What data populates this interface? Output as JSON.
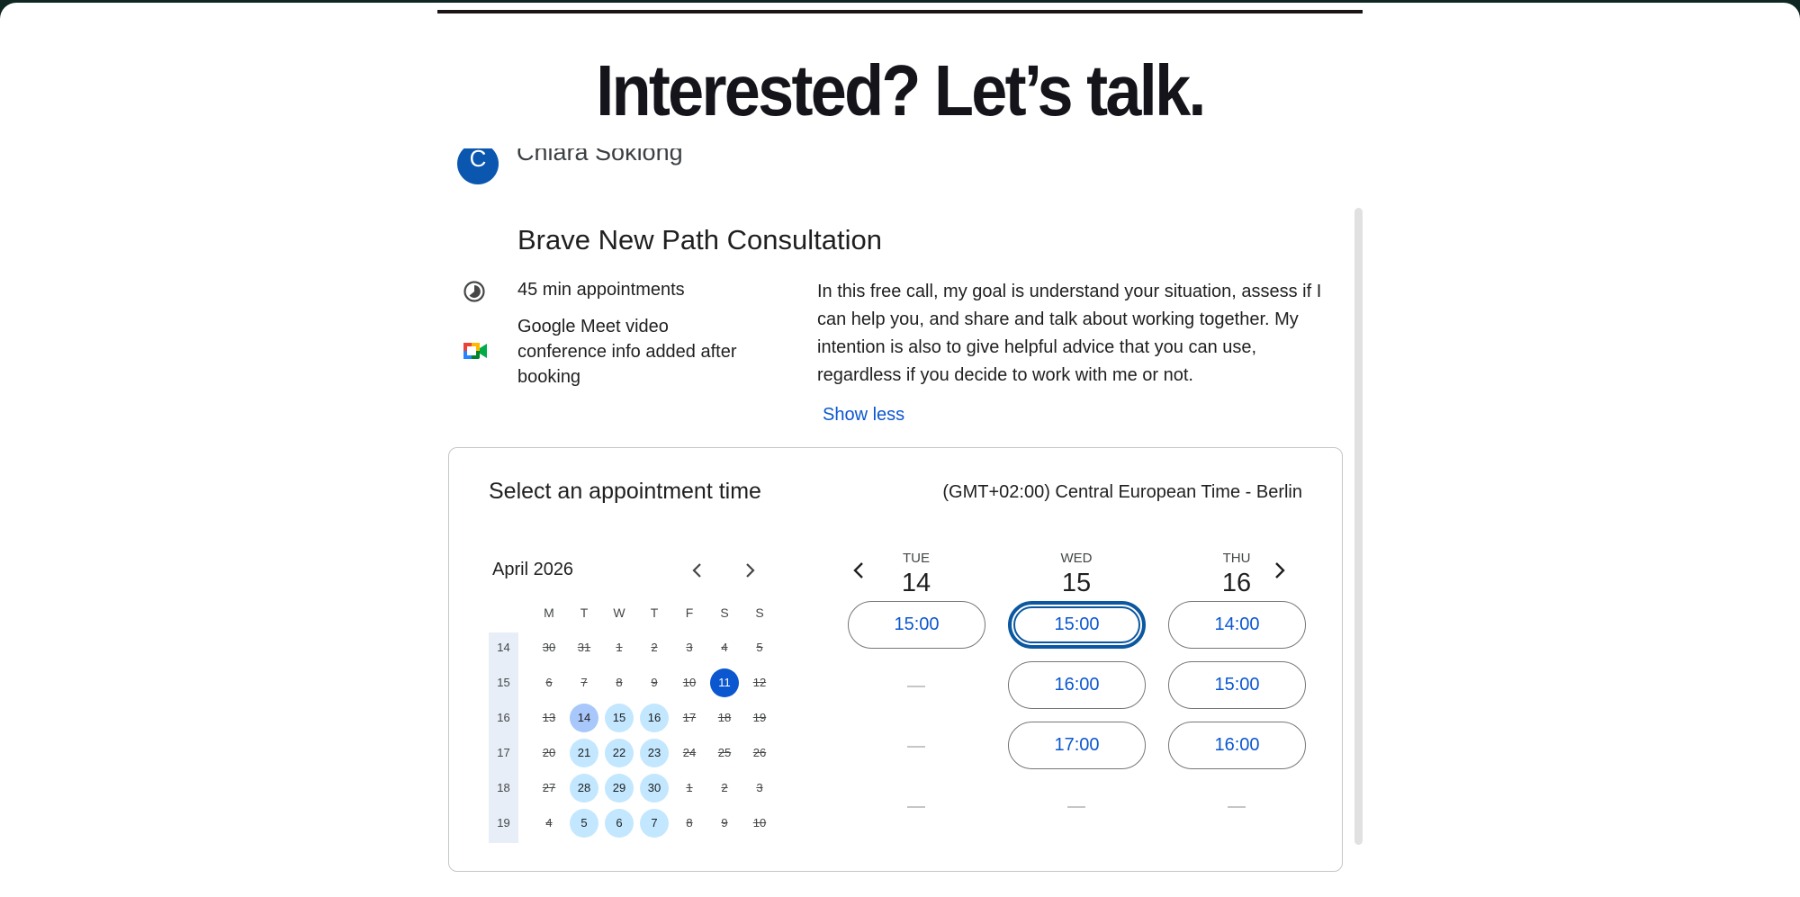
{
  "headline": "Interested? Let’s talk.",
  "host": {
    "initial": "C",
    "name": "Chiara Soklong"
  },
  "event": {
    "title": "Brave New Path Consultation",
    "duration": "45 min appointments",
    "conference": "Google Meet video conference info added after booking",
    "description": "In this free call, my goal is understand your situation, assess if I can help you, and share and talk about working together. My intention is also to give helpful advice that you can use, regardless if you decide to work with me or not.",
    "show_less": "Show less"
  },
  "booking": {
    "title": "Select an appointment time",
    "timezone": "(GMT+02:00) Central European Time - Berlin"
  },
  "calendar": {
    "month": "April 2026",
    "weekdays": [
      "M",
      "T",
      "W",
      "T",
      "F",
      "S",
      "S"
    ],
    "weeks": [
      {
        "num": "14",
        "days": [
          {
            "d": "30",
            "s": "dis"
          },
          {
            "d": "31",
            "s": "dis"
          },
          {
            "d": "1",
            "s": "dis"
          },
          {
            "d": "2",
            "s": "dis"
          },
          {
            "d": "3",
            "s": "dis"
          },
          {
            "d": "4",
            "s": "dis"
          },
          {
            "d": "5",
            "s": "dis"
          }
        ]
      },
      {
        "num": "15",
        "days": [
          {
            "d": "6",
            "s": "dis"
          },
          {
            "d": "7",
            "s": "dis"
          },
          {
            "d": "8",
            "s": "dis"
          },
          {
            "d": "9",
            "s": "dis"
          },
          {
            "d": "10",
            "s": "dis"
          },
          {
            "d": "11",
            "s": "today"
          },
          {
            "d": "12",
            "s": "dis"
          }
        ]
      },
      {
        "num": "16",
        "days": [
          {
            "d": "13",
            "s": "dis"
          },
          {
            "d": "14",
            "s": "sel"
          },
          {
            "d": "15",
            "s": "avail"
          },
          {
            "d": "16",
            "s": "avail"
          },
          {
            "d": "17",
            "s": "dis"
          },
          {
            "d": "18",
            "s": "dis"
          },
          {
            "d": "19",
            "s": "dis"
          }
        ]
      },
      {
        "num": "17",
        "days": [
          {
            "d": "20",
            "s": "dis"
          },
          {
            "d": "21",
            "s": "avail"
          },
          {
            "d": "22",
            "s": "avail"
          },
          {
            "d": "23",
            "s": "avail"
          },
          {
            "d": "24",
            "s": "dis"
          },
          {
            "d": "25",
            "s": "dis"
          },
          {
            "d": "26",
            "s": "dis"
          }
        ]
      },
      {
        "num": "18",
        "days": [
          {
            "d": "27",
            "s": "dis"
          },
          {
            "d": "28",
            "s": "avail"
          },
          {
            "d": "29",
            "s": "avail"
          },
          {
            "d": "30",
            "s": "avail"
          },
          {
            "d": "1",
            "s": "dis"
          },
          {
            "d": "2",
            "s": "dis"
          },
          {
            "d": "3",
            "s": "dis"
          }
        ]
      },
      {
        "num": "19",
        "days": [
          {
            "d": "4",
            "s": "dis"
          },
          {
            "d": "5",
            "s": "avail"
          },
          {
            "d": "6",
            "s": "avail"
          },
          {
            "d": "7",
            "s": "avail"
          },
          {
            "d": "8",
            "s": "dis"
          },
          {
            "d": "9",
            "s": "dis"
          },
          {
            "d": "10",
            "s": "dis"
          }
        ]
      }
    ]
  },
  "columns": [
    {
      "dow": "TUE",
      "date": "14",
      "slots": [
        "15:00",
        "",
        "",
        ""
      ]
    },
    {
      "dow": "WED",
      "date": "15",
      "slots": [
        "15:00",
        "16:00",
        "17:00",
        ""
      ]
    },
    {
      "dow": "THU",
      "date": "16",
      "slots": [
        "14:00",
        "15:00",
        "16:00",
        ""
      ]
    }
  ],
  "focused_slot": "WED 15:00"
}
